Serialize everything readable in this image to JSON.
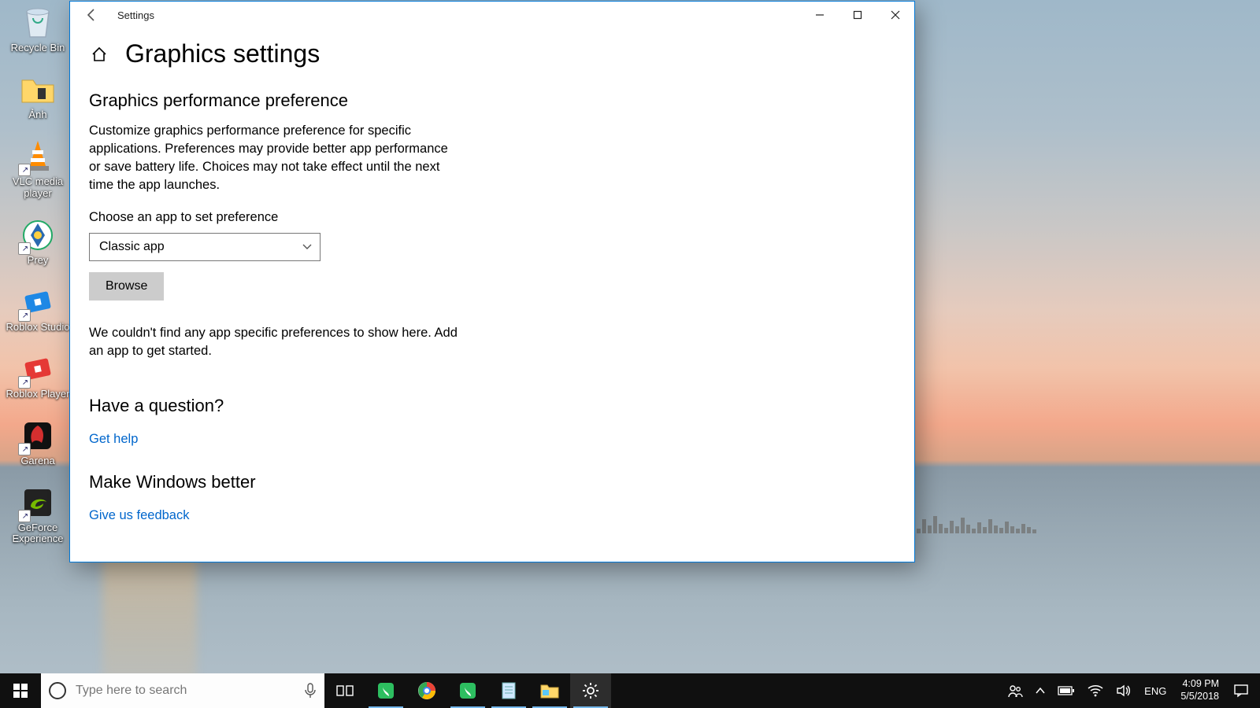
{
  "desktop": {
    "icons": [
      {
        "label": "Recycle Bin"
      },
      {
        "label": "Ảnh"
      },
      {
        "label": "VLC media player"
      },
      {
        "label": "Prey"
      },
      {
        "label": "Roblox Studio"
      },
      {
        "label": "Roblox Player"
      },
      {
        "label": "Garena"
      },
      {
        "label": "GeForce Experience"
      }
    ]
  },
  "window": {
    "title": "Settings",
    "page_title": "Graphics settings",
    "section1_heading": "Graphics performance preference",
    "description": "Customize graphics performance preference for specific applications. Preferences may provide better app performance or save battery life. Choices may not take effect until the next time the app launches.",
    "choose_label": "Choose an app to set preference",
    "combo_value": "Classic app",
    "browse_label": "Browse",
    "empty_text": "We couldn't find any app specific preferences to show here. Add an app to get started.",
    "question_heading": "Have a question?",
    "get_help": "Get help",
    "feedback_heading": "Make Windows better",
    "feedback_link": "Give us feedback"
  },
  "taskbar": {
    "search_placeholder": "Type here to search",
    "lang": "ENG",
    "time": "4:09 PM",
    "date": "5/5/2018"
  }
}
